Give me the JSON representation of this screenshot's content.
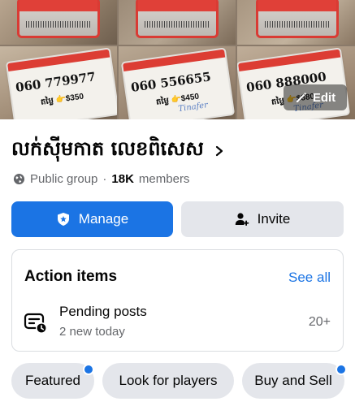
{
  "cover": {
    "cards": [
      {
        "number": "060 779977",
        "price": "តម្លៃ 👉$350"
      },
      {
        "number": "060 556655",
        "price": "តម្លៃ 👉$450",
        "sig": "Tinafer"
      },
      {
        "number": "060 888000",
        "price": "តម្លៃ 👉$880",
        "sig": "Tinafer"
      }
    ],
    "edit_label": "Edit"
  },
  "group": {
    "name": "លក់ស៊ីមកាត លេខពិសេស",
    "privacy": "Public group",
    "separator": "·",
    "members_count": "18K",
    "members_label": "members"
  },
  "buttons": {
    "manage": "Manage",
    "invite": "Invite"
  },
  "action_items": {
    "title": "Action items",
    "see_all": "See all",
    "row": {
      "title": "Pending posts",
      "subtitle": "2 new today",
      "count": "20+"
    }
  },
  "chips": [
    "Featured",
    "Look for players",
    "Buy and Sell"
  ],
  "colors": {
    "primary": "#1b74e4",
    "secondary_bg": "#e4e6eb",
    "text": "#050505",
    "muted": "#65676b"
  }
}
